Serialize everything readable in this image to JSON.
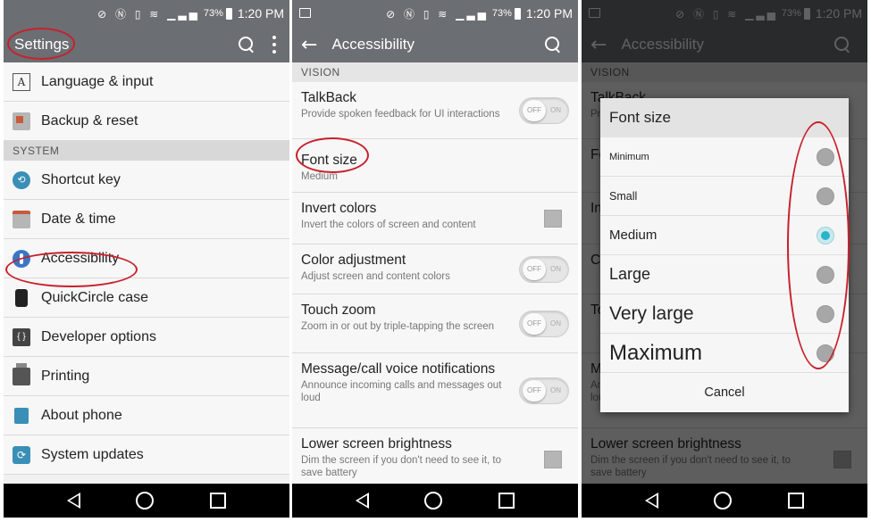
{
  "status": {
    "battery": "73%",
    "time": "1:20 PM",
    "icons": "⊘ Ⓝ ▯ ≋ ▁▃▅"
  },
  "panel1": {
    "title": "Settings",
    "items_top": [
      {
        "label": "Language & input",
        "icon": "language-icon"
      },
      {
        "label": "Backup & reset",
        "icon": "backup-icon"
      }
    ],
    "section": "SYSTEM",
    "items": [
      {
        "label": "Shortcut key",
        "icon": "shortcut-key-icon"
      },
      {
        "label": "Date & time",
        "icon": "calendar-icon"
      },
      {
        "label": "Accessibility",
        "icon": "accessibility-icon"
      },
      {
        "label": "QuickCircle case",
        "icon": "quickcircle-icon"
      },
      {
        "label": "Developer options",
        "icon": "developer-icon"
      },
      {
        "label": "Printing",
        "icon": "printer-icon"
      },
      {
        "label": "About phone",
        "icon": "info-icon"
      },
      {
        "label": "System updates",
        "icon": "update-icon"
      }
    ]
  },
  "panel2": {
    "title": "Accessibility",
    "section": "VISION",
    "rows": [
      {
        "title": "TalkBack",
        "subtitle": "Provide spoken feedback for UI interactions",
        "control": "toggle"
      },
      {
        "title": "Font size",
        "subtitle": "Medium",
        "control": "none"
      },
      {
        "title": "Invert colors",
        "subtitle": "Invert the colors of screen and content",
        "control": "checkbox"
      },
      {
        "title": "Color adjustment",
        "subtitle": "Adjust screen and content colors",
        "control": "toggle"
      },
      {
        "title": "Touch zoom",
        "subtitle": "Zoom in or out by triple-tapping the screen",
        "control": "toggle"
      },
      {
        "title": "Message/call voice notifications",
        "subtitle": "Announce incoming calls and messages out loud",
        "control": "toggle"
      },
      {
        "title": "Lower screen brightness",
        "subtitle": "Dim the screen if you don't need to see it, to save battery",
        "control": "checkbox"
      }
    ],
    "toggle_off": "OFF",
    "toggle_on": "ON"
  },
  "panel3": {
    "dialog_title": "Font size",
    "options": [
      {
        "label": "Minimum",
        "size": 11
      },
      {
        "label": "Small",
        "size": 12.5
      },
      {
        "label": "Medium",
        "size": 15
      },
      {
        "label": "Large",
        "size": 18
      },
      {
        "label": "Very large",
        "size": 21
      },
      {
        "label": "Maximum",
        "size": 24
      }
    ],
    "selected_option": "Medium",
    "cancel": "Cancel"
  },
  "colors": {
    "action_bar": "#6b6e72",
    "annotation_red": "#c8202c",
    "radio_selected": "#29b4c8"
  }
}
